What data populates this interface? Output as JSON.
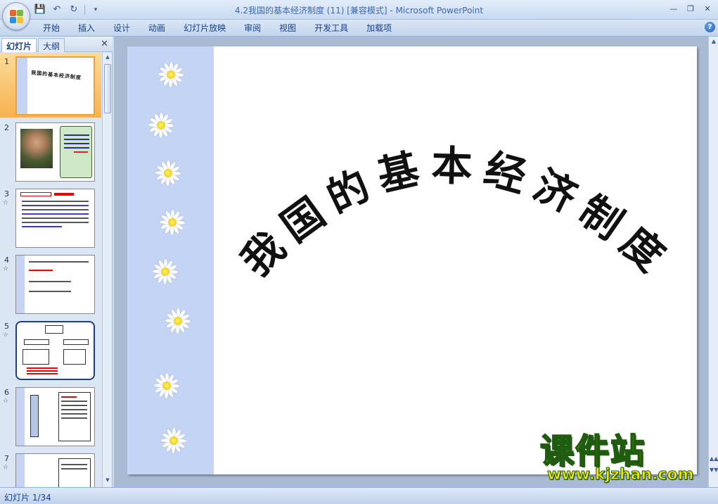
{
  "window": {
    "title": "4.2我国的基本经济制度 (11) [兼容模式] - Microsoft PowerPoint"
  },
  "ribbon": {
    "tabs": [
      "开始",
      "插入",
      "设计",
      "动画",
      "幻灯片放映",
      "审阅",
      "视图",
      "开发工具",
      "加载项"
    ]
  },
  "panel": {
    "tab_slides": "幻灯片",
    "tab_outline": "大纲"
  },
  "thumbnails": [
    {
      "num": "1",
      "active": true
    },
    {
      "num": "2",
      "active": false
    },
    {
      "num": "3",
      "active": false
    },
    {
      "num": "4",
      "active": false
    },
    {
      "num": "5",
      "active": false
    },
    {
      "num": "6",
      "active": false
    },
    {
      "num": "7",
      "active": false
    }
  ],
  "slide": {
    "title": "我国的基本经济制度"
  },
  "watermark": {
    "main": "课件站",
    "url": "www.kjzhan.com"
  },
  "status": {
    "slide_counter": "幻灯片 1/34"
  },
  "colors": {
    "slide_bar": "#c4d4f4",
    "active_thumb": "#f7b24f",
    "watermark_yellow": "#f2e600"
  }
}
